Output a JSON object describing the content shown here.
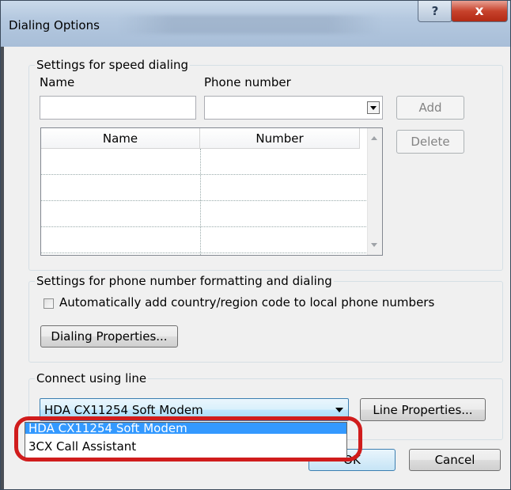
{
  "window": {
    "title": "Dialing Options",
    "help_glyph": "?",
    "close_glyph": "x"
  },
  "speed_dialing": {
    "group_label": "Settings for speed dialing",
    "name_label": "Name",
    "phone_label": "Phone number",
    "name_value": "",
    "phone_value": "",
    "add_label": "Add",
    "delete_label": "Delete",
    "table": {
      "columns": [
        "Name",
        "Number"
      ],
      "rows": [
        [
          "",
          ""
        ],
        [
          "",
          ""
        ],
        [
          "",
          ""
        ],
        [
          "",
          ""
        ]
      ]
    }
  },
  "formatting": {
    "group_label": "Settings for phone number formatting and dialing",
    "checkbox_label": "Automatically add country/region code to local phone numbers",
    "checkbox_checked": false,
    "properties_label": "Dialing Properties..."
  },
  "line": {
    "group_label": "Connect using line",
    "selected": "HDA CX11254 Soft Modem",
    "properties_label": "Line Properties...",
    "options": [
      "HDA CX11254 Soft Modem",
      "3CX Call Assistant"
    ]
  },
  "footer": {
    "ok_label": "OK",
    "cancel_label": "Cancel"
  },
  "colors": {
    "highlight_ring": "#d01c1c",
    "selection": "#3399ff"
  }
}
